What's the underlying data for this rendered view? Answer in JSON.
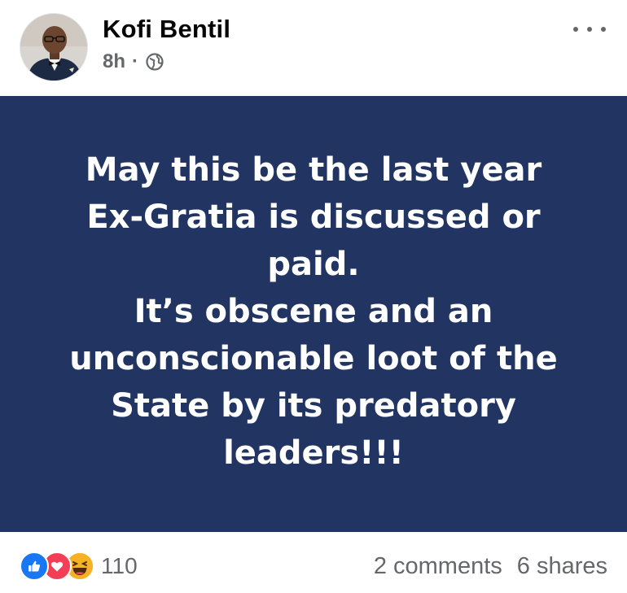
{
  "post": {
    "author": "Kofi Bentil",
    "time": "8h",
    "separator": "·",
    "privacy_icon": "globe-icon",
    "more_icon": "more-horizontal-icon"
  },
  "banner": {
    "background": "#213462",
    "lines": [
      "May this be the last year",
      "Ex-Gratia is discussed or",
      "paid.",
      "It’s obscene and an",
      "unconscionable loot of the",
      "State by its predatory",
      "leaders!!!"
    ]
  },
  "footer": {
    "reaction_icons": [
      "like-icon",
      "love-icon",
      "haha-icon"
    ],
    "reaction_count": "110",
    "comments": "2 comments",
    "shares": "6 shares"
  },
  "colors": {
    "text_primary": "#050505",
    "text_secondary": "#65676b",
    "like": "#1877f2",
    "love": "#f33e58",
    "haha": "#f7b125"
  }
}
